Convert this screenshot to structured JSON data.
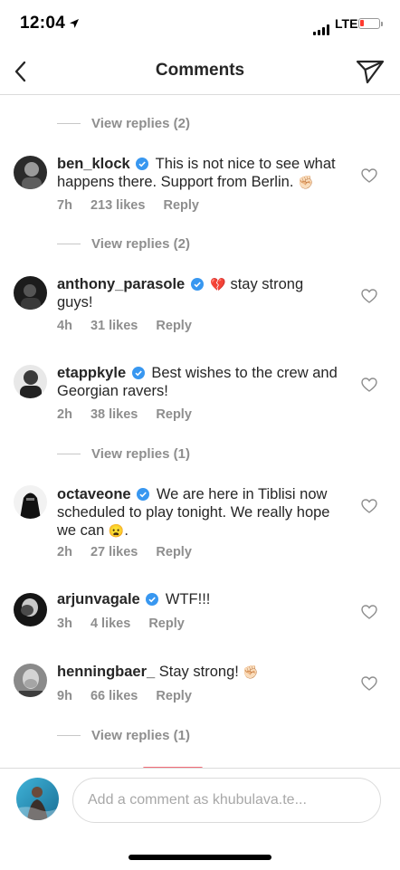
{
  "status_bar": {
    "time": "12:04",
    "network": "LTE"
  },
  "header": {
    "title": "Comments"
  },
  "view_replies": [
    {
      "label": "View replies (2)"
    },
    {
      "label": "View replies (2)"
    },
    {
      "label": "View replies (1)"
    },
    {
      "label": "View replies (1)"
    }
  ],
  "comments": [
    {
      "username": "ben_klock",
      "verified": true,
      "text": "This is not nice to see what happens there. Support from Berlin.",
      "emoji": "✊🏻",
      "time": "7h",
      "likes": "213 likes",
      "reply_label": "Reply"
    },
    {
      "username": "anthony_parasole",
      "verified": true,
      "emoji_before": "💔",
      "text": "stay strong guys!",
      "time": "4h",
      "likes": "31 likes",
      "reply_label": "Reply"
    },
    {
      "username": "etappkyle",
      "verified": true,
      "text": "Best wishes to the crew and Georgian ravers!",
      "time": "2h",
      "likes": "38 likes",
      "reply_label": "Reply"
    },
    {
      "username": "octaveone",
      "verified": true,
      "text": "We are here in Tiblisi now scheduled to play tonight. We really hope we can",
      "emoji": "😦",
      "text_after": ".",
      "time": "2h",
      "likes": "27 likes",
      "reply_label": "Reply"
    },
    {
      "username": "arjunvagale",
      "verified": true,
      "text": "WTF!!!",
      "time": "3h",
      "likes": "4 likes",
      "reply_label": "Reply"
    },
    {
      "username": "henningbaer_",
      "verified": false,
      "text": "Stay strong!",
      "emoji": "✊🏻",
      "time": "9h",
      "likes": "66 likes",
      "reply_label": "Reply"
    }
  ],
  "composer": {
    "placeholder": "Add a comment as khubulava.te..."
  },
  "colors": {
    "text": "#262626",
    "secondary": "#8e8e8e",
    "verified": "#3897f0",
    "divider": "#dbdbdb",
    "battery_low": "#ff3b30"
  },
  "icons": {
    "back": "chevron-left-icon",
    "send": "paper-plane-icon",
    "like": "heart-outline-icon",
    "verified": "verified-badge-icon"
  }
}
